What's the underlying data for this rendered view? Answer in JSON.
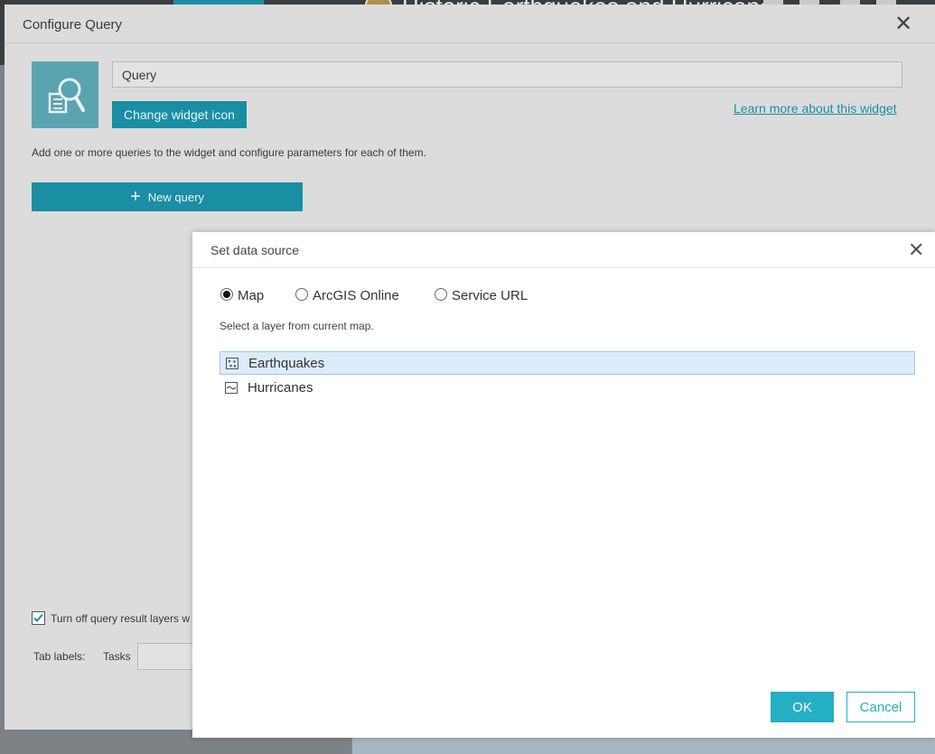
{
  "background": {
    "app_title": "Historic Earthquakes and Hurricanes"
  },
  "configure_panel": {
    "title": "Configure Query",
    "widget_name": "Query",
    "change_icon_label": "Change widget icon",
    "learn_more_label": "Learn more about this widget",
    "description": "Add one or more queries to the widget and configure parameters for each of them.",
    "new_query_label": "New query",
    "turn_off_label": "Turn off query result layers w",
    "turn_off_checked": true,
    "tab_labels_label": "Tab labels:",
    "tasks_label": "Tasks"
  },
  "data_source_dialog": {
    "title": "Set data source",
    "source_options": [
      {
        "label": "Map",
        "selected": true
      },
      {
        "label": "ArcGIS Online",
        "selected": false
      },
      {
        "label": "Service URL",
        "selected": false
      }
    ],
    "hint": "Select a layer from current map.",
    "layers": [
      {
        "label": "Earthquakes",
        "icon": "point-layer-icon",
        "selected": true
      },
      {
        "label": "Hurricanes",
        "icon": "line-layer-icon",
        "selected": false
      }
    ],
    "ok_label": "OK",
    "cancel_label": "Cancel"
  },
  "colors": {
    "accent": "#1a8ea3",
    "ok_button": "#25afc5",
    "selected_row": "#dcecfa"
  }
}
